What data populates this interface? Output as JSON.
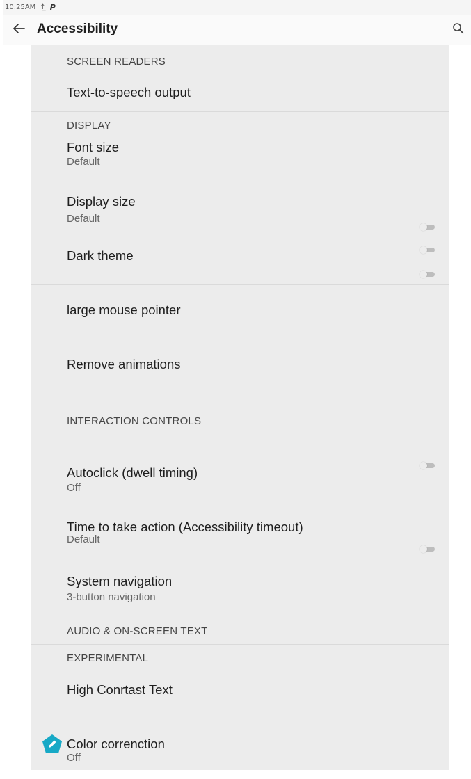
{
  "status_bar": {
    "time": "10:25AM",
    "icons": [
      "upload-icon",
      "p-icon"
    ]
  },
  "app_bar": {
    "title": "Accessibility",
    "icons": [
      "back-arrow-icon",
      "search-icon"
    ]
  },
  "sections": {
    "screen_readers": {
      "header": "SCREEN READERS",
      "tts": {
        "title": "Text-to-speech output"
      }
    },
    "display": {
      "header": "DISPLAY",
      "font_size": {
        "title": "Font size",
        "subtitle": "Default"
      },
      "display_size": {
        "title": "Display size",
        "subtitle": "Default"
      },
      "dark_theme": {
        "title": "Dark theme",
        "toggle": "off"
      },
      "large_pointer": {
        "title": "large mouse pointer",
        "toggle": "off"
      },
      "remove_animations": {
        "title": "Remove animations",
        "toggle": "off"
      }
    },
    "interaction": {
      "header": "INTERACTION CONTROLS",
      "autoclick": {
        "title": "Autoclick (dwell timing)",
        "subtitle": "Off"
      },
      "timeout": {
        "title": "Time to take action (Accessibility timeout)",
        "subtitle": "Default",
        "toggle": "off"
      },
      "system_nav": {
        "title": "System navigation",
        "subtitle": "3-button navigation",
        "toggle": "off"
      }
    },
    "audio": {
      "header": "AUDIO & ON-SCREEN TEXT"
    },
    "experimental": {
      "header": "EXPERIMENTAL",
      "high_contrast": {
        "title": "High Conrtast Text"
      },
      "color_correction": {
        "title": "Color correnction",
        "subtitle": "Off"
      }
    }
  },
  "colors": {
    "panel_bg": "#ececec",
    "fab_accent": "#17a9c6",
    "toggle_track": "#bdbdbd"
  }
}
